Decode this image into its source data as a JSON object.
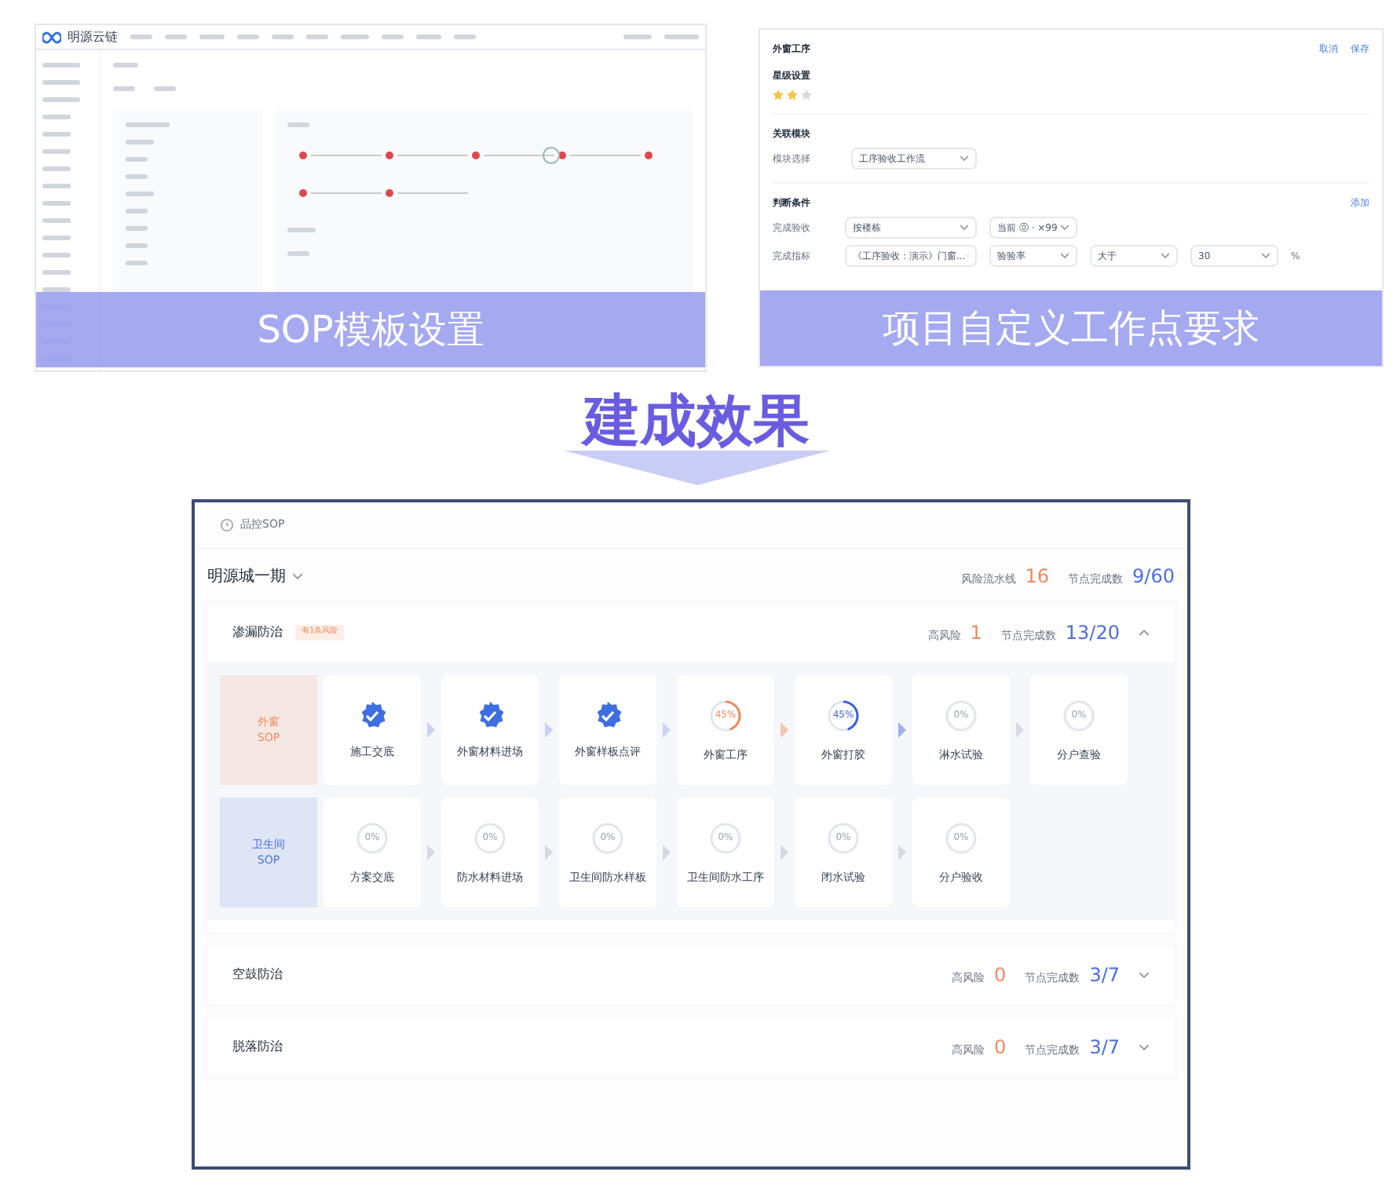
{
  "template_shot": {
    "logo": "明源云链",
    "caption": "SOP模板设置"
  },
  "custom_shot": {
    "title": "外窗工序",
    "actions": [
      "取消",
      "保存"
    ],
    "star_title": "星级设置",
    "stars": 2,
    "module_title": "关联模块",
    "module_label": "模块选择",
    "module_value": "工序验收工作流",
    "cond_title": "判断条件",
    "cond_add": "添加",
    "cond_rows": [
      {
        "label": "完成验收",
        "fields": [
          "按楼栋",
          "当前 ⓪ · ×99"
        ]
      },
      {
        "label": "完成指标",
        "fields": [
          "《工序验收：演示》门窗...",
          "验验率",
          "大于",
          "30"
        ],
        "unit": "%"
      }
    ],
    "caption": "项目自定义工作点要求"
  },
  "headline": "建成效果",
  "result": {
    "breadcrumb": "品控SOP",
    "project": "明源城一期",
    "stats": [
      {
        "label": "风险流水线",
        "value": "16",
        "kind": "risk"
      },
      {
        "label": "节点完成数",
        "value": "9/60",
        "kind": "progress"
      }
    ],
    "sections": [
      {
        "title": "渗漏防治",
        "tag": "有1条风险",
        "expanded": true,
        "stats": [
          {
            "label": "高风险",
            "value": "1",
            "kind": "risk"
          },
          {
            "label": "节点完成数",
            "value": "13/20",
            "kind": "progress"
          }
        ],
        "groups": [
          {
            "name": "外窗",
            "suffix": "SOP",
            "color": "#f08a5d",
            "nodes": [
              {
                "label": "施工交底",
                "kind": "done"
              },
              {
                "label": "外窗材料进场",
                "kind": "done"
              },
              {
                "label": "外窗样板点评",
                "kind": "done"
              },
              {
                "label": "外窗工序",
                "kind": "progress",
                "percent": "45%",
                "level": 0.45,
                "color": "#f08a5d"
              },
              {
                "label": "外窗打胶",
                "kind": "progress",
                "percent": "45%",
                "level": 0.45,
                "color": "#3b63d9"
              },
              {
                "label": "淋水试验",
                "kind": "todo",
                "percent": "0%"
              },
              {
                "label": "分户查验",
                "kind": "todo",
                "percent": "0%"
              }
            ]
          },
          {
            "name": "卫生间",
            "suffix": "SOP",
            "color": "#4a6fdc",
            "nodes": [
              {
                "label": "方案交底",
                "kind": "todo",
                "percent": "0%"
              },
              {
                "label": "防水材料进场",
                "kind": "todo",
                "percent": "0%"
              },
              {
                "label": "卫生间防水样板",
                "kind": "todo",
                "percent": "0%"
              },
              {
                "label": "卫生间防水工序",
                "kind": "todo",
                "percent": "0%"
              },
              {
                "label": "闭水试验",
                "kind": "todo",
                "percent": "0%"
              },
              {
                "label": "分户验收",
                "kind": "todo",
                "percent": "0%"
              }
            ]
          }
        ]
      },
      {
        "title": "空鼓防治",
        "expanded": false,
        "stats": [
          {
            "label": "高风险",
            "value": "0",
            "kind": "risk"
          },
          {
            "label": "节点完成数",
            "value": "3/7",
            "kind": "progress"
          }
        ]
      },
      {
        "title": "脱落防治",
        "expanded": false,
        "stats": [
          {
            "label": "高风险",
            "value": "0",
            "kind": "risk"
          },
          {
            "label": "节点完成数",
            "value": "3/7",
            "kind": "progress"
          }
        ]
      }
    ]
  }
}
